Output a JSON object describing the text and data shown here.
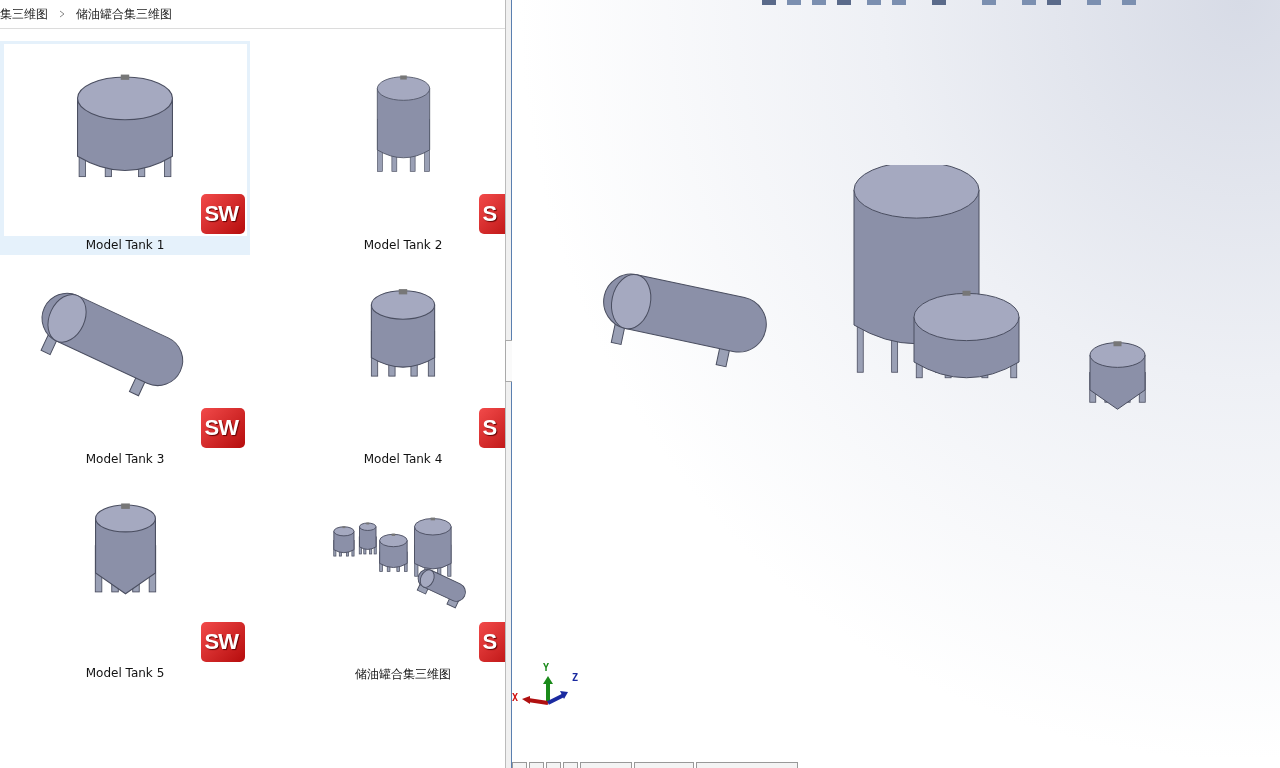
{
  "breadcrumb": [
    {
      "label": "集三维图"
    },
    {
      "label": "储油罐合集三维图"
    }
  ],
  "files": [
    {
      "name": "Model Tank 1",
      "kind": "wide",
      "badge": "SW",
      "selected": true
    },
    {
      "name": "Model Tank 2",
      "kind": "vertical",
      "badge": "S",
      "selected": false
    },
    {
      "name": "Model Tank 3",
      "kind": "horizontal",
      "badge": "SW",
      "selected": false
    },
    {
      "name": "Model Tank 4",
      "kind": "dome",
      "badge": "S",
      "selected": false
    },
    {
      "name": "Model Tank 5",
      "kind": "cone",
      "badge": "SW",
      "selected": false
    },
    {
      "name": "储油罐合集三维图",
      "kind": "group",
      "badge": "S",
      "selected": false
    }
  ],
  "viewport": {
    "axes": [
      "X",
      "Y",
      "Z"
    ]
  }
}
